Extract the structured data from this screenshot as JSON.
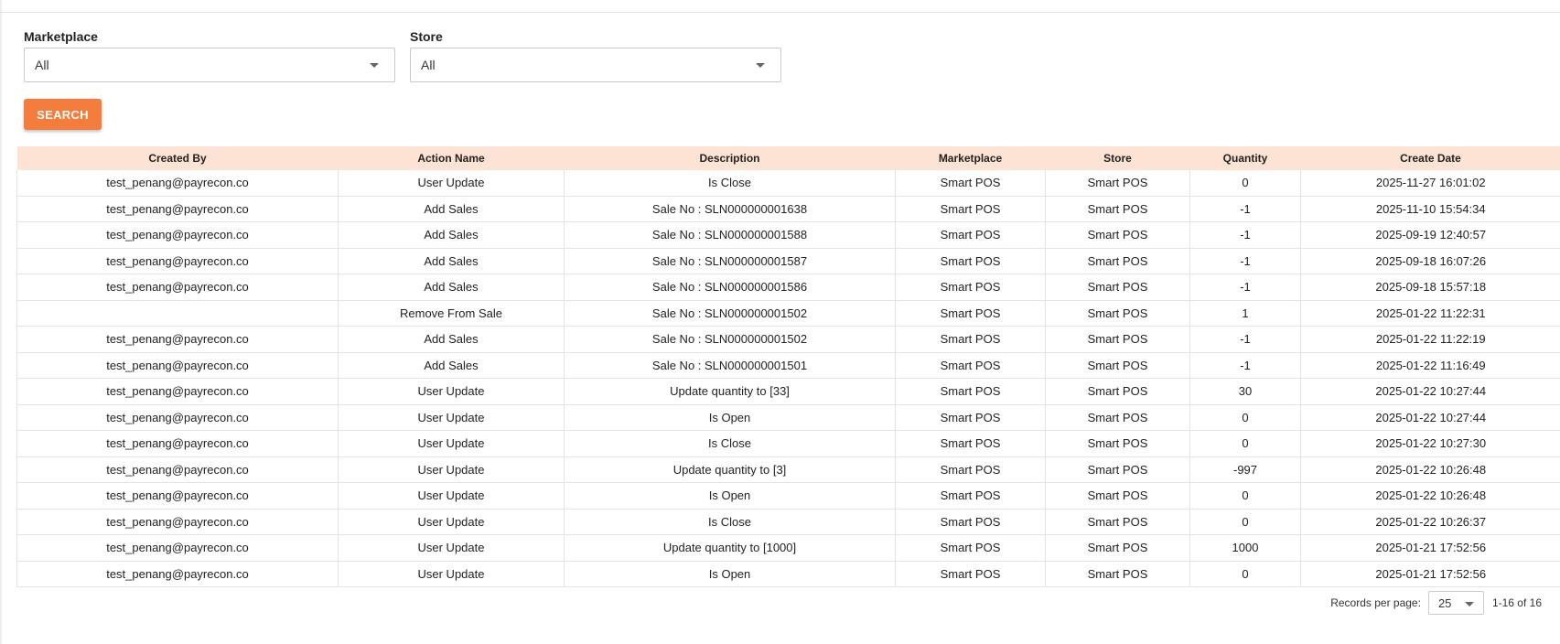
{
  "filters": {
    "marketplace": {
      "label": "Marketplace",
      "value": "All"
    },
    "store": {
      "label": "Store",
      "value": "All"
    }
  },
  "search_button": "SEARCH",
  "table": {
    "columns": [
      "Created By",
      "Action Name",
      "Description",
      "Marketplace",
      "Store",
      "Quantity",
      "Create Date"
    ],
    "rows": [
      [
        "test_penang@payrecon.co",
        "User Update",
        "Is Close",
        "Smart POS",
        "Smart POS",
        "0",
        "2025-11-27 16:01:02"
      ],
      [
        "test_penang@payrecon.co",
        "Add Sales",
        "Sale No : SLN000000001638",
        "Smart POS",
        "Smart POS",
        "-1",
        "2025-11-10 15:54:34"
      ],
      [
        "test_penang@payrecon.co",
        "Add Sales",
        "Sale No : SLN000000001588",
        "Smart POS",
        "Smart POS",
        "-1",
        "2025-09-19 12:40:57"
      ],
      [
        "test_penang@payrecon.co",
        "Add Sales",
        "Sale No : SLN000000001587",
        "Smart POS",
        "Smart POS",
        "-1",
        "2025-09-18 16:07:26"
      ],
      [
        "test_penang@payrecon.co",
        "Add Sales",
        "Sale No : SLN000000001586",
        "Smart POS",
        "Smart POS",
        "-1",
        "2025-09-18 15:57:18"
      ],
      [
        "",
        "Remove From Sale",
        "Sale No : SLN000000001502",
        "Smart POS",
        "Smart POS",
        "1",
        "2025-01-22 11:22:31"
      ],
      [
        "test_penang@payrecon.co",
        "Add Sales",
        "Sale No : SLN000000001502",
        "Smart POS",
        "Smart POS",
        "-1",
        "2025-01-22 11:22:19"
      ],
      [
        "test_penang@payrecon.co",
        "Add Sales",
        "Sale No : SLN000000001501",
        "Smart POS",
        "Smart POS",
        "-1",
        "2025-01-22 11:16:49"
      ],
      [
        "test_penang@payrecon.co",
        "User Update",
        "Update quantity to [33]",
        "Smart POS",
        "Smart POS",
        "30",
        "2025-01-22 10:27:44"
      ],
      [
        "test_penang@payrecon.co",
        "User Update",
        "Is Open",
        "Smart POS",
        "Smart POS",
        "0",
        "2025-01-22 10:27:44"
      ],
      [
        "test_penang@payrecon.co",
        "User Update",
        "Is Close",
        "Smart POS",
        "Smart POS",
        "0",
        "2025-01-22 10:27:30"
      ],
      [
        "test_penang@payrecon.co",
        "User Update",
        "Update quantity to [3]",
        "Smart POS",
        "Smart POS",
        "-997",
        "2025-01-22 10:26:48"
      ],
      [
        "test_penang@payrecon.co",
        "User Update",
        "Is Open",
        "Smart POS",
        "Smart POS",
        "0",
        "2025-01-22 10:26:48"
      ],
      [
        "test_penang@payrecon.co",
        "User Update",
        "Is Close",
        "Smart POS",
        "Smart POS",
        "0",
        "2025-01-22 10:26:37"
      ],
      [
        "test_penang@payrecon.co",
        "User Update",
        "Update quantity to [1000]",
        "Smart POS",
        "Smart POS",
        "1000",
        "2025-01-21 17:52:56"
      ],
      [
        "test_penang@payrecon.co",
        "User Update",
        "Is Open",
        "Smart POS",
        "Smart POS",
        "0",
        "2025-01-21 17:52:56"
      ]
    ]
  },
  "pagination": {
    "label": "Records per page:",
    "per_page": "25",
    "range": "1-16 of 16"
  },
  "colors": {
    "accent": "#f47c3c",
    "header_bg": "#fde3d3"
  },
  "icons": {
    "dropdown": "caret-down-icon"
  }
}
